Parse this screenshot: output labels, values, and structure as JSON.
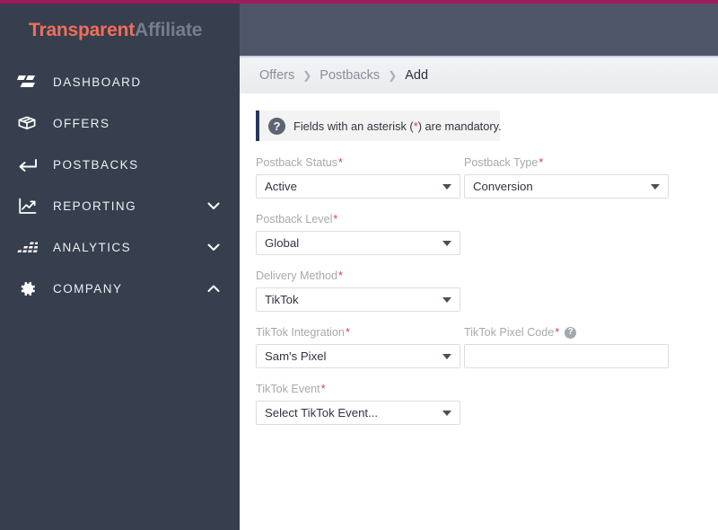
{
  "brand": {
    "name_part1": "Transparent",
    "name_part2": "Affiliate",
    "accent_color": "#ef6f5b",
    "muted_color": "#767d8c",
    "top_accent_color": "#9c1a5e",
    "sidebar_color": "#373e4d",
    "header_color": "#4e5569"
  },
  "sidebar": {
    "items": [
      {
        "label": "DASHBOARD",
        "icon": "dashboard-icon",
        "chevron": ""
      },
      {
        "label": "OFFERS",
        "icon": "box-icon",
        "chevron": ""
      },
      {
        "label": "POSTBACKS",
        "icon": "return-arrow-icon",
        "chevron": ""
      },
      {
        "label": "REPORTING",
        "icon": "line-chart-icon",
        "chevron": "down"
      },
      {
        "label": "ANALYTICS",
        "icon": "bar-chart-icon",
        "chevron": "down"
      },
      {
        "label": "COMPANY",
        "icon": "gear-icon",
        "chevron": "up"
      }
    ]
  },
  "breadcrumb": {
    "items": [
      {
        "label": "Offers",
        "current": false
      },
      {
        "label": "Postbacks",
        "current": false
      },
      {
        "label": "Add",
        "current": true
      }
    ],
    "separator": "❯"
  },
  "alert": {
    "icon": "question-mark-icon",
    "glyph": "?",
    "text_before": "Fields with an asterisk (",
    "asterisk": "*",
    "text_after": ") are mandatory.",
    "accent_color": "#27375c"
  },
  "form": {
    "required_marker": "*",
    "help_glyph": "?",
    "fields": {
      "postback_status": {
        "label": "Postback Status",
        "value": "Active",
        "type": "select"
      },
      "postback_type": {
        "label": "Postback Type",
        "value": "Conversion",
        "type": "select"
      },
      "postback_level": {
        "label": "Postback Level",
        "value": "Global",
        "type": "select"
      },
      "delivery_method": {
        "label": "Delivery Method",
        "value": "TikTok",
        "type": "select"
      },
      "tiktok_integration": {
        "label": "TikTok Integration",
        "value": "Sam's Pixel",
        "type": "select"
      },
      "tiktok_pixel_code": {
        "label": "TikTok Pixel Code",
        "value": "",
        "placeholder": "",
        "type": "text",
        "has_help": true
      },
      "tiktok_event": {
        "label": "TikTok Event",
        "value": "Select TikTok Event...",
        "type": "select"
      }
    }
  }
}
